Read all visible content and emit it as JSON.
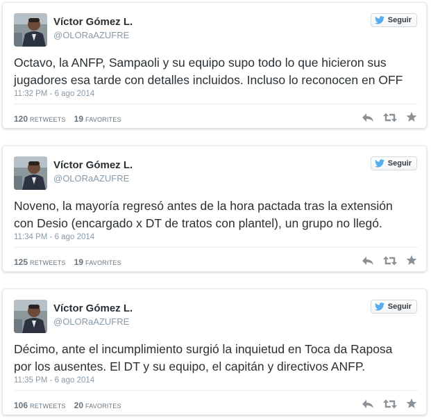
{
  "colors": {
    "text": "#292f33",
    "muted": "#8899a6",
    "twitter_blue": "#55acee",
    "icon_gray": "#8a9299"
  },
  "icons": {
    "follow": "twitter-bird-icon",
    "reply": "reply-icon",
    "retweet": "retweet-icon",
    "favorite": "star-icon"
  },
  "tweets": [
    {
      "name": "Víctor Gómez L.",
      "handle": "@OLORaAZUFRE",
      "follow_label": "Seguir",
      "text": "Octavo, la ANFP, Sampaoli y su equipo supo todo lo que hicieron sus\njugadores esa tarde con detalles incluidos. Incluso lo reconocen en OFF",
      "time": "11:32 PM - 6 ago 2014",
      "retweets": "120",
      "retweets_label": "RETWEETS",
      "favorites": "19",
      "favorites_label": "FAVORITES"
    },
    {
      "name": "Víctor Gómez L.",
      "handle": "@OLORaAZUFRE",
      "follow_label": "Seguir",
      "text": "Noveno, la mayoría regresó antes de la hora pactada tras la extensión\ncon Desio (encargado x DT de tratos con plantel), un grupo no llegó.",
      "time": "11:34 PM - 6 ago 2014",
      "retweets": "125",
      "retweets_label": "RETWEETS",
      "favorites": "19",
      "favorites_label": "FAVORITES"
    },
    {
      "name": "Víctor Gómez L.",
      "handle": "@OLORaAZUFRE",
      "follow_label": "Seguir",
      "text": "Décimo, ante el incumplimiento surgió la inquietud en Toca da Raposa\npor los ausentes. El DT y su equipo, el capitán y directivos ANFP.",
      "time": "11:35 PM - 6 ago 2014",
      "retweets": "106",
      "retweets_label": "RETWEETS",
      "favorites": "20",
      "favorites_label": "FAVORITES"
    }
  ]
}
